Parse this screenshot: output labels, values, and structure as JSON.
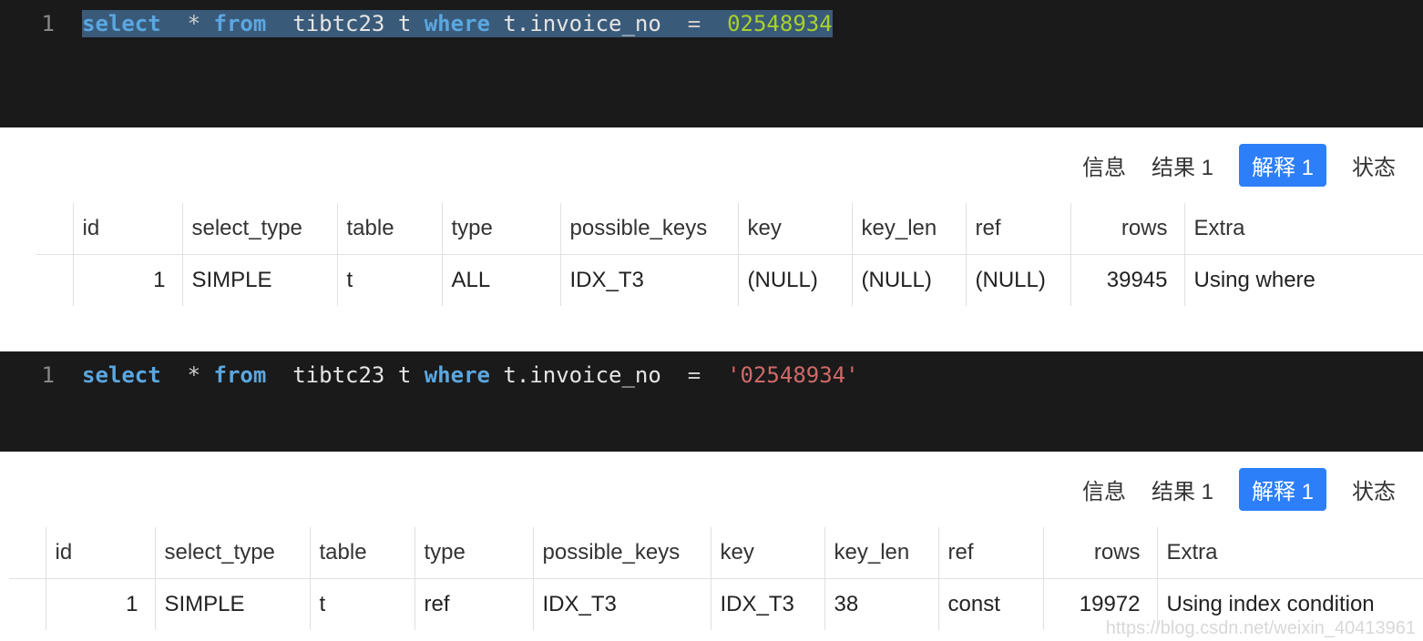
{
  "panels": [
    {
      "line_no": "1",
      "sql_tokens": [
        {
          "t": "select",
          "c": "kw",
          "sel": true
        },
        {
          "t": "  ",
          "c": "",
          "sel": true
        },
        {
          "t": "*",
          "c": "op",
          "sel": true
        },
        {
          "t": " ",
          "c": "",
          "sel": true
        },
        {
          "t": "from",
          "c": "kw",
          "sel": true
        },
        {
          "t": "  ",
          "c": "",
          "sel": true
        },
        {
          "t": "tibtc23 t",
          "c": "id",
          "sel": true
        },
        {
          "t": " ",
          "c": "",
          "sel": true
        },
        {
          "t": "where",
          "c": "kw2",
          "sel": true
        },
        {
          "t": " ",
          "c": "",
          "sel": true
        },
        {
          "t": "t.invoice_no",
          "c": "id",
          "sel": true
        },
        {
          "t": "  ",
          "c": "",
          "sel": true
        },
        {
          "t": "=",
          "c": "op",
          "sel": true
        },
        {
          "t": "  ",
          "c": "",
          "sel": true
        },
        {
          "t": "02548934",
          "c": "num",
          "sel": true
        }
      ],
      "tabs": [
        {
          "label": "信息",
          "active": false
        },
        {
          "label": "结果 1",
          "active": false
        },
        {
          "label": "解释 1",
          "active": true
        },
        {
          "label": "状态",
          "active": false
        }
      ],
      "table": {
        "offset": 40,
        "headers": [
          "id",
          "select_type",
          "table",
          "type",
          "possible_keys",
          "key",
          "key_len",
          "ref",
          "rows",
          "Extra"
        ],
        "row": {
          "id": "1",
          "select_type": "SIMPLE",
          "table": "t",
          "type": "ALL",
          "possible_keys": "IDX_T3",
          "key": "(NULL)",
          "key_len": "(NULL)",
          "ref": "(NULL)",
          "rows": "39945",
          "extra": "Using where"
        },
        "nulls": {
          "key": true,
          "key_len": true,
          "ref": true
        }
      },
      "editor_short": false
    },
    {
      "line_no": "1",
      "sql_tokens": [
        {
          "t": "select",
          "c": "kw",
          "sel": false
        },
        {
          "t": "  ",
          "c": "",
          "sel": false
        },
        {
          "t": "*",
          "c": "op",
          "sel": false
        },
        {
          "t": " ",
          "c": "",
          "sel": false
        },
        {
          "t": "from",
          "c": "kw",
          "sel": false
        },
        {
          "t": "  ",
          "c": "",
          "sel": false
        },
        {
          "t": "tibtc23 t",
          "c": "id",
          "sel": false
        },
        {
          "t": " ",
          "c": "",
          "sel": false
        },
        {
          "t": "where",
          "c": "kw2",
          "sel": false
        },
        {
          "t": " ",
          "c": "",
          "sel": false
        },
        {
          "t": "t.invoice_no",
          "c": "id",
          "sel": false
        },
        {
          "t": "  ",
          "c": "",
          "sel": false
        },
        {
          "t": "=",
          "c": "op",
          "sel": false
        },
        {
          "t": "  ",
          "c": "",
          "sel": false
        },
        {
          "t": "'02548934'",
          "c": "str",
          "sel": false
        }
      ],
      "tabs": [
        {
          "label": "信息",
          "active": false
        },
        {
          "label": "结果 1",
          "active": false
        },
        {
          "label": "解释 1",
          "active": true
        },
        {
          "label": "状态",
          "active": false
        }
      ],
      "table": {
        "offset": 10,
        "headers": [
          "id",
          "select_type",
          "table",
          "type",
          "possible_keys",
          "key",
          "key_len",
          "ref",
          "rows",
          "Extra"
        ],
        "row": {
          "id": "1",
          "select_type": "SIMPLE",
          "table": "t",
          "type": "ref",
          "possible_keys": "IDX_T3",
          "key": "IDX_T3",
          "key_len": "38",
          "ref": "const",
          "rows": "19972",
          "extra": "Using index condition"
        },
        "nulls": {}
      },
      "editor_short": true
    }
  ],
  "watermark": "https://blog.csdn.net/weixin_40413961"
}
